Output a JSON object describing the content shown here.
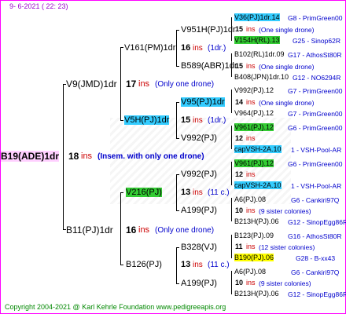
{
  "date": "9-  6-2021 ( 22: 23)",
  "footer": "Copyright 2004-2021 @ Karl Kehrle Foundation    www.pedigreeapis.org",
  "root": {
    "id": "B19(ADE)1dr",
    "ins_num": "18",
    "ins": "ins",
    "note": "(Insem. with only one drone)"
  },
  "gen1": [
    {
      "id": "V9(JMD)1dr",
      "ins_num": "17",
      "ins": "ins",
      "note": "(Only one drone)"
    },
    {
      "id": "B11(PJ)1dr",
      "ins_num": "16",
      "ins": "ins",
      "note": "(Only one drone)"
    }
  ],
  "gen2": [
    {
      "id": "V161(PM)1dr",
      "ins_num": "16",
      "ins": "ins",
      "note": "(1dr.)"
    },
    {
      "id": "V5H(PJ)1dr",
      "ins_num": "15",
      "ins": "ins",
      "note": "(1dr.)"
    },
    {
      "id": "V216(PJ)",
      "ins_num": "13",
      "ins": "ins",
      "note": "(11 c.)"
    },
    {
      "id": "B126(PJ)",
      "ins_num": "13",
      "ins": "ins",
      "note": "(11 c.)"
    }
  ],
  "gen3": [
    {
      "id": "V951H(PJ)1dr"
    },
    {
      "id": "B589(ABR)1dr"
    },
    {
      "id": "V95(PJ)1dr"
    },
    {
      "id": "V992(PJ)"
    },
    {
      "id": "V992(PJ)"
    },
    {
      "id": "A199(PJ)"
    },
    {
      "id": "B328(VJ)"
    },
    {
      "id": "A199(PJ)"
    }
  ],
  "gen4": [
    {
      "id": "V36(PJ)1dr.14",
      "right": "G8 - PrimGreen00"
    },
    {
      "num": "15",
      "ins": "ins",
      "note": "(One single drone)"
    },
    {
      "id": "V154H(RL).13",
      "right": "G25 - Sinop62R"
    },
    {
      "id": "B102(RL)1dr.09",
      "right": "G17 - AthosSt80R"
    },
    {
      "num": "15",
      "ins": "ins",
      "note": "(One single drone)"
    },
    {
      "id": "B408(JPN)1dr.10",
      "right": "G12 - NO6294R"
    },
    {
      "id": "V992(PJ).12",
      "right": "G7 - PrimGreen00"
    },
    {
      "num": "14",
      "ins": "ins",
      "note": "(One single drone)"
    },
    {
      "id": "V964(PJ).12",
      "right": "G7 - PrimGreen00"
    },
    {
      "id": "V961(PJ).12",
      "right": "G6 - PrimGreen00"
    },
    {
      "num": "12",
      "ins": "ins",
      "note": ""
    },
    {
      "id": "capVSH-2A.10",
      "right": "1 - VSH-Pool-AR"
    },
    {
      "id": "V961(PJ).12",
      "right": "G6 - PrimGreen00"
    },
    {
      "num": "12",
      "ins": "ins",
      "note": ""
    },
    {
      "id": "capVSH-2A.10",
      "right": "1 - VSH-Pool-AR"
    },
    {
      "id": "A6(PJ).08",
      "right": "G6 - Cankiri97Q"
    },
    {
      "num": "10",
      "ins": "ins",
      "note": "(9 sister colonies)"
    },
    {
      "id": "B213H(PJ).06",
      "right": "G12 - SinopEgg86R"
    },
    {
      "id": "B123(PJ).09",
      "right": "G16 - AthosSt80R"
    },
    {
      "num": "11",
      "ins": "ins",
      "note": "(12 sister colonies)"
    },
    {
      "id": "B190(PJ).06",
      "right": "G28 - B-xx43"
    },
    {
      "id": "A6(PJ).08",
      "right": "G6 - Cankiri97Q"
    },
    {
      "num": "10",
      "ins": "ins",
      "note": "(9 sister colonies)"
    },
    {
      "id": "B213H(PJ).06",
      "right": "G12 - SinopEgg86R"
    }
  ]
}
